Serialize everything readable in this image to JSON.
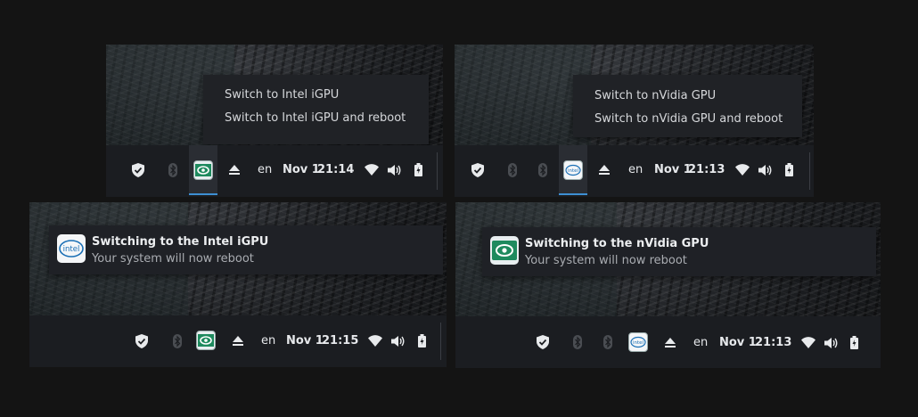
{
  "colors": {
    "accent": "#3d8fd4",
    "bar_bg": "#1b1d21",
    "menu_bg": "#202226"
  },
  "panels": {
    "top_left": {
      "menu": {
        "items": [
          "Switch to Intel iGPU",
          "Switch to Intel iGPU and reboot"
        ]
      },
      "tray": {
        "lang": "en",
        "date": "Nov 1",
        "time": "21:14",
        "gpu_icon": "nvidia-icon"
      }
    },
    "top_right": {
      "menu": {
        "items": [
          "Switch to nVidia GPU",
          "Switch to nVidia GPU and reboot"
        ]
      },
      "tray": {
        "lang": "en",
        "date": "Nov 1",
        "time": "21:13",
        "gpu_icon": "intel-icon"
      }
    },
    "bottom_left": {
      "notification": {
        "title": "Switching to the Intel iGPU",
        "body": "Your system will now reboot",
        "icon": "intel-icon"
      },
      "tray": {
        "lang": "en",
        "date": "Nov 1",
        "time": "21:15",
        "gpu_icon": "nvidia-icon"
      }
    },
    "bottom_right": {
      "notification": {
        "title": "Switching to the nVidia GPU",
        "body": "Your system will now reboot",
        "icon": "nvidia-icon"
      },
      "tray": {
        "lang": "en",
        "date": "Nov 1",
        "time": "21:13",
        "gpu_icon": "intel-icon"
      }
    }
  },
  "icons": {
    "intel_logo_text": "intel"
  }
}
